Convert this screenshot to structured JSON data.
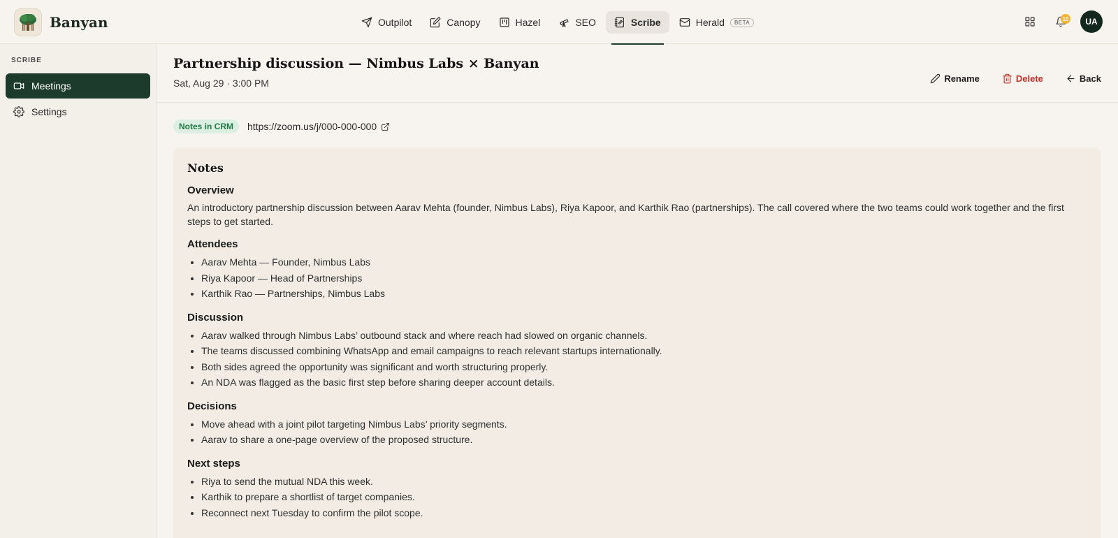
{
  "brand": {
    "name": "Banyan"
  },
  "nav": {
    "tabs": [
      {
        "label": "Outpilot",
        "icon": "send-icon"
      },
      {
        "label": "Canopy",
        "icon": "edit-icon"
      },
      {
        "label": "Hazel",
        "icon": "kanban-icon"
      },
      {
        "label": "SEO",
        "icon": "telescope-icon"
      },
      {
        "label": "Scribe",
        "icon": "notebook-icon",
        "active": true
      },
      {
        "label": "Herald",
        "icon": "mail-icon",
        "badge": "BETA"
      }
    ]
  },
  "topright": {
    "notification_count": "10",
    "avatar_initials": "UA"
  },
  "sidebar": {
    "section": "SCRIBE",
    "items": [
      {
        "label": "Meetings",
        "icon": "video-icon",
        "active": true
      },
      {
        "label": "Settings",
        "icon": "gear-icon"
      }
    ]
  },
  "meeting": {
    "title": "Partnership discussion — Nimbus Labs × Banyan",
    "datetime": "Sat, Aug 29 · 3:00 PM",
    "actions": {
      "rename": "Rename",
      "delete": "Delete",
      "back": "Back"
    },
    "crm_badge": "Notes in CRM",
    "link": "https://zoom.us/j/000-000-000"
  },
  "notes": {
    "title": "Notes",
    "overview": {
      "heading": "Overview",
      "text": "An introductory partnership discussion between Aarav Mehta (founder, Nimbus Labs), Riya Kapoor, and Karthik Rao (partnerships). The call covered where the two teams could work together and the first steps to get started."
    },
    "attendees": {
      "heading": "Attendees",
      "items": [
        "Aarav Mehta — Founder, Nimbus Labs",
        "Riya Kapoor — Head of Partnerships",
        "Karthik Rao — Partnerships, Nimbus Labs"
      ]
    },
    "discussion": {
      "heading": "Discussion",
      "items": [
        "Aarav walked through Nimbus Labs’ outbound stack and where reach had slowed on organic channels.",
        "The teams discussed combining WhatsApp and email campaigns to reach relevant startups internationally.",
        "Both sides agreed the opportunity was significant and worth structuring properly.",
        "An NDA was flagged as the basic first step before sharing deeper account details."
      ]
    },
    "decisions": {
      "heading": "Decisions",
      "items": [
        "Move ahead with a joint pilot targeting Nimbus Labs’ priority segments.",
        "Aarav to share a one-page overview of the proposed structure."
      ]
    },
    "next_steps": {
      "heading": "Next steps",
      "items": [
        "Riya to send the mutual NDA this week.",
        "Karthik to prepare a shortlist of target companies.",
        "Reconnect next Tuesday to confirm the pilot scope."
      ]
    }
  }
}
